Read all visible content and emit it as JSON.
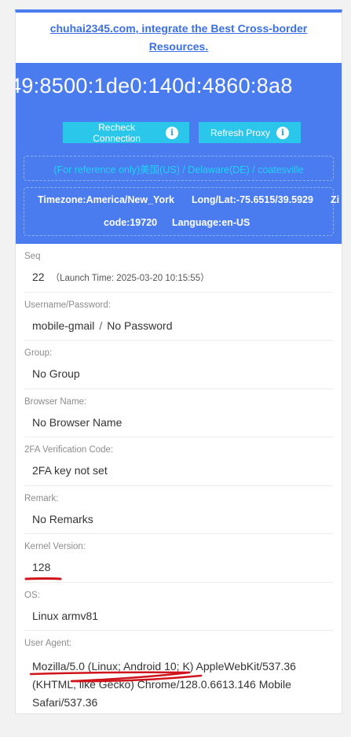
{
  "promo": {
    "link_text": "chuhai2345.com, integrate the Best Cross-border Resources."
  },
  "proxy": {
    "ip_display": "49:8500:1de0:140d:4860:8a8",
    "buttons": [
      {
        "label": "Recheck Connection",
        "icon": "info-icon"
      },
      {
        "label": "Refresh Proxy",
        "icon": "info-icon"
      }
    ],
    "location": "(For reference only)美国(US) / Delaware(DE) / coatesville",
    "timezone": "Timezone:America/New_York",
    "long_lat": "Long/Lat:-75.6515/39.5929",
    "zip_prefix": "Zi",
    "zip_code": "code:19720",
    "language": "Language:en-US",
    "colors": {
      "panel": "#4a7cf0",
      "button": "#2bc7ea",
      "location_text": "#21d1f4"
    }
  },
  "fields": {
    "seq": {
      "label": "Seq",
      "value": "22",
      "launch_time": "（Launch Time: 2025-03-20 10:15:55）"
    },
    "credentials": {
      "label": "Username/Password:",
      "username": "mobile-gmail",
      "separator": "/",
      "password": "No Password"
    },
    "group": {
      "label": "Group:",
      "value": "No Group"
    },
    "browser_name": {
      "label": "Browser Name:",
      "value": "No Browser Name"
    },
    "twofa": {
      "label": "2FA Verification Code:",
      "value": "2FA key not set"
    },
    "remark": {
      "label": "Remark:",
      "value": "No Remarks"
    },
    "kernel": {
      "label": "Kernel Version:",
      "value": "128"
    },
    "os": {
      "label": "OS:",
      "value": "Linux armv81"
    },
    "user_agent": {
      "label": "User Agent:",
      "line1": "Mozilla/5.0 (Linux; Android 10; K) AppleWebKit/537.36",
      "line2": "(KHTML, like Gecko) Chrome/128.0.6613.146 Mobile",
      "line3": "Safari/537.36"
    }
  },
  "annotation_color": "#d0141c"
}
